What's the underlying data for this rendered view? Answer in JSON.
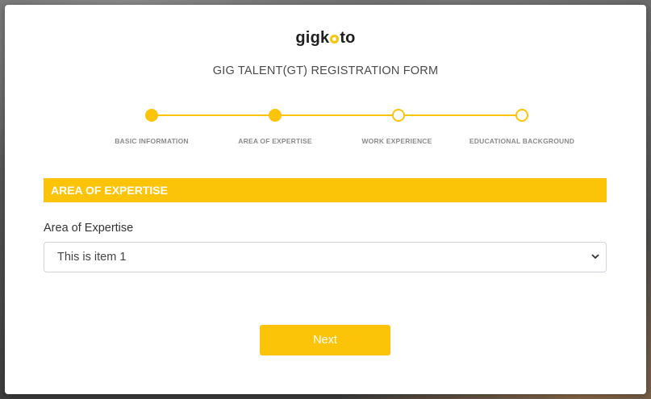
{
  "brand": {
    "logo_prefix": "gig",
    "logo_suffix": "to",
    "accent_color": "#fcc408"
  },
  "form": {
    "title": "GIG TALENT(GT) REGISTRATION FORM"
  },
  "stepper": {
    "current_step": 2,
    "steps": [
      {
        "label": "BASIC INFORMATION",
        "status": "done"
      },
      {
        "label": "AREA OF EXPERTISE",
        "status": "current"
      },
      {
        "label": "WORK EXPERIENCE",
        "status": "pending"
      },
      {
        "label": "EDUCATIONAL BACKGROUND",
        "status": "pending"
      }
    ]
  },
  "section": {
    "header": "AREA OF EXPERTISE",
    "field_label": "Area of Expertise",
    "selected_value": "This is item 1",
    "chevron_icon": "chevron-down-icon"
  },
  "actions": {
    "next_label": "Next"
  }
}
